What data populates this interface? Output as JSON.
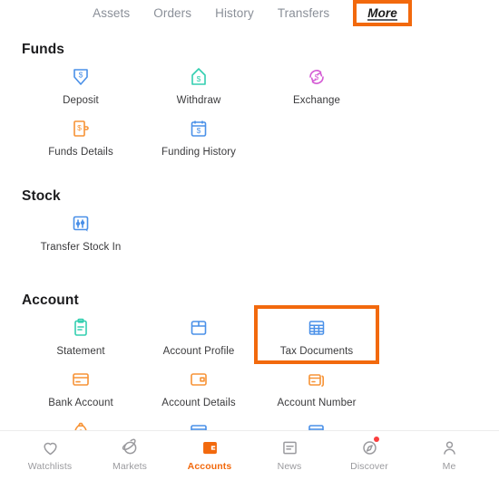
{
  "top_tabs": [
    {
      "label": "Assets",
      "active": false
    },
    {
      "label": "Orders",
      "active": false
    },
    {
      "label": "History",
      "active": false
    },
    {
      "label": "Transfers",
      "active": false
    },
    {
      "label": "More",
      "active": true
    }
  ],
  "sections": [
    {
      "title": "Funds",
      "items": [
        {
          "label": "Deposit",
          "icon": "deposit-arrow-dollar-icon",
          "color": "#4a90e8",
          "highlight": false
        },
        {
          "label": "Withdraw",
          "icon": "withdraw-house-dollar-icon",
          "color": "#33cfb0",
          "highlight": false
        },
        {
          "label": "Exchange",
          "icon": "exchange-circular-dollar-icon",
          "color": "#d45ad4",
          "highlight": false
        },
        {
          "label": "Funds Details",
          "icon": "funds-details-document-dollar-icon",
          "color": "#f79336",
          "highlight": false
        },
        {
          "label": "Funding History",
          "icon": "funding-history-calendar-dollar-icon",
          "color": "#4a90e8",
          "highlight": false
        }
      ]
    },
    {
      "title": "Stock",
      "items": [
        {
          "label": "Transfer Stock In",
          "icon": "transfer-stock-chart-icon",
          "color": "#4a90e8",
          "highlight": false
        }
      ]
    },
    {
      "title": "Account",
      "items": [
        {
          "label": "Statement",
          "icon": "statement-clipboard-icon",
          "color": "#33cfb0",
          "highlight": false
        },
        {
          "label": "Account Profile",
          "icon": "account-profile-window-icon",
          "color": "#4a90e8",
          "highlight": false
        },
        {
          "label": "Tax Documents",
          "icon": "tax-documents-table-icon",
          "color": "#4a90e8",
          "highlight": true
        },
        {
          "label": "Bank Account",
          "icon": "bank-account-card-icon",
          "color": "#f79336",
          "highlight": false
        },
        {
          "label": "Account Details",
          "icon": "account-details-wallet-icon",
          "color": "#f79336",
          "highlight": false
        },
        {
          "label": "Account Number",
          "icon": "account-number-cards-icon",
          "color": "#f79336",
          "highlight": false
        },
        {
          "label": "",
          "icon": "money-bag-icon",
          "color": "#f79336",
          "highlight": false
        },
        {
          "label": "",
          "icon": "card-settings-icon",
          "color": "#4a90e8",
          "highlight": false
        },
        {
          "label": "",
          "icon": "card-add-icon",
          "color": "#4a90e8",
          "highlight": false
        }
      ]
    }
  ],
  "bottom_nav": [
    {
      "label": "Watchlists",
      "icon": "heart-icon",
      "active": false,
      "badge": false
    },
    {
      "label": "Markets",
      "icon": "planet-icon",
      "active": false,
      "badge": false
    },
    {
      "label": "Accounts",
      "icon": "wallet-icon",
      "active": true,
      "badge": false
    },
    {
      "label": "News",
      "icon": "document-icon",
      "active": false,
      "badge": false
    },
    {
      "label": "Discover",
      "icon": "compass-icon",
      "active": false,
      "badge": true
    },
    {
      "label": "Me",
      "icon": "person-icon",
      "active": false,
      "badge": false
    }
  ],
  "colors": {
    "highlight_orange": "#f2690d",
    "accent_orange": "#f2690d",
    "badge_red": "#fa3e3e",
    "label_grey": "#9a9a9e"
  }
}
